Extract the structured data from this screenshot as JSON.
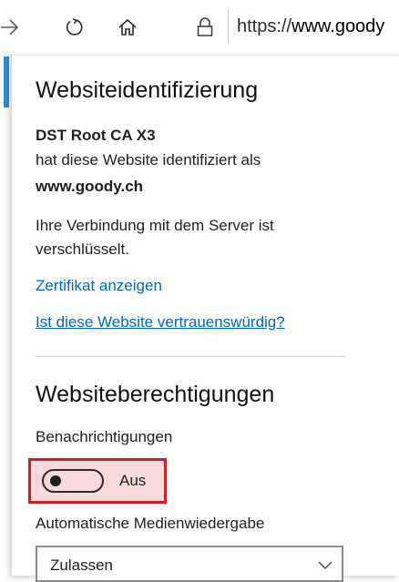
{
  "toolbar": {
    "url_scheme": "https://",
    "url_host": "www.goody",
    "icons": [
      "forward-icon",
      "refresh-icon",
      "home-icon",
      "lock-icon"
    ]
  },
  "identification": {
    "title": "Websiteidentifizierung",
    "issuer": "DST Root CA X3",
    "identified_text": "hat diese Website identifiziert als",
    "domain": "www.goody.ch",
    "encryption_line1": "Ihre Verbindung mit dem Server ist",
    "encryption_line2": "verschlüsselt.",
    "certificate_link": "Zertifikat anzeigen",
    "trust_link": "Ist diese Website vertrauenswürdig?"
  },
  "permissions": {
    "title": "Websiteberechtigungen",
    "notifications_label": "Benachrichtigungen",
    "notifications_toggle": {
      "state": "off",
      "label": "Aus"
    },
    "autoplay_label": "Automatische Medienwiedergabe",
    "autoplay_select_value": "Zulassen"
  },
  "colors": {
    "accent": "#2a8fd8",
    "link": "#0067c0",
    "highlight_border": "#d01e2a",
    "highlight_fill": "#f6dadb"
  }
}
